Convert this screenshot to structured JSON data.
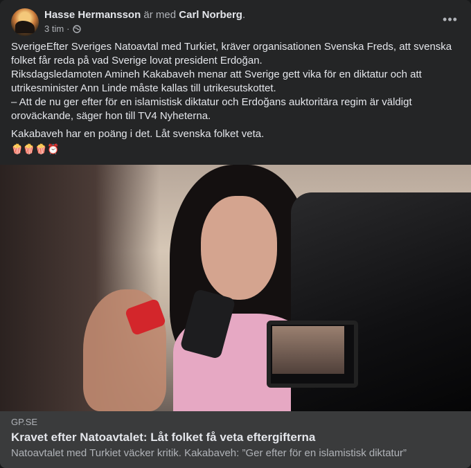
{
  "post": {
    "author": "Hasse Hermansson",
    "with_text": "är med",
    "tagged": "Carl Norberg",
    "time": "3 tim",
    "more_label": "•••",
    "paragraph1": [
      "SverigeEfter Sveriges Natoavtal med Turkiet, kräver organisationen Svenska Freds, att svenska",
      "folket får reda på vad Sverige lovat president Erdoğan.",
      "Riksdagsledamoten Amineh Kakabaveh menar att Sverige gett vika för en diktatur och att",
      "utrikesminister Ann Linde måste kallas till utrikesutskottet.",
      "– Att de nu ger efter för en islamistisk diktatur och Erdoğans auktoritära regim är väldigt",
      "oroväckande, säger hon till TV4 Nyheterna."
    ],
    "paragraph2": "Kakabaveh har en poäng i det. Låt svenska folket veta.",
    "emojis": "🍿🍿🍿⏰"
  },
  "link": {
    "domain": "GP.SE",
    "title": "Kravet efter Natoavtalet: Låt folket få veta eftergifterna",
    "description": "Natoavtalet med Turkiet väcker kritik. Kakabaveh: ”Ger efter för en islamistisk diktatur”"
  },
  "icons": {
    "avatar": "profile-avatar",
    "privacy": "globe-icon",
    "menu": "more-options-icon"
  }
}
